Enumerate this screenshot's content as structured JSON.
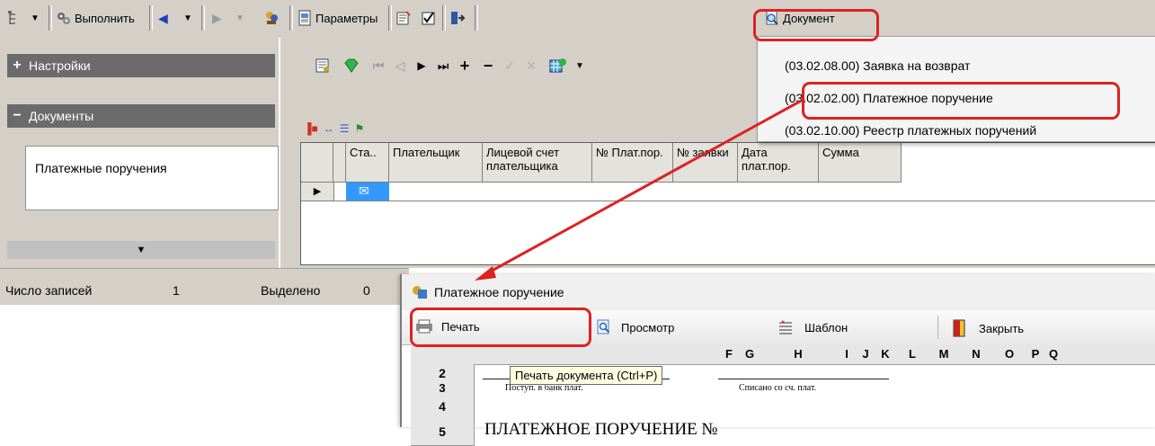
{
  "toolbar": {
    "run_label": "Выполнить",
    "params_label": "Параметры",
    "document_label": "Документ"
  },
  "left_panel": {
    "settings_label": "Настройки",
    "documents_label": "Документы",
    "documents_item": "Платежные поручения"
  },
  "grid": {
    "columns": [
      "Ста..",
      "Плательщик",
      "Лицевой счет плательщика",
      "№ Плат.пор.",
      "№ заявки",
      "Дата плат.пор.",
      "Сумма"
    ]
  },
  "status": {
    "records_label": "Число записей",
    "records_value": "1",
    "selected_label": "Выделено",
    "selected_value": "0"
  },
  "document_menu": {
    "items": [
      "(03.02.08.00) Заявка на возврат",
      "(03.02.02.00) Платежное поручение",
      "(03.02.10.00) Реестр платежных поручений"
    ],
    "highlighted_index": 1
  },
  "payment_window": {
    "title": "Платежное поручение",
    "print_label": "Печать",
    "preview_label": "Просмотр",
    "template_label": "Шаблон",
    "close_label": "Закрыть",
    "tooltip": "Печать документа (Ctrl+P)",
    "columns": [
      "F",
      "G",
      "H",
      "I",
      "J",
      "K",
      "L",
      "M",
      "N",
      "O",
      "P",
      "Q"
    ],
    "rows": [
      "2",
      "3",
      "4",
      "5"
    ],
    "row3_left": "Поступ. в банк плат.",
    "row3_right": "Списано со сч. плат.",
    "row5_title": "ПЛАТЕЖНОЕ ПОРУЧЕНИЕ №"
  },
  "colors": {
    "annotation": "#dd2222",
    "group_header": "#6b6b6b",
    "selection": "#3399ff"
  }
}
